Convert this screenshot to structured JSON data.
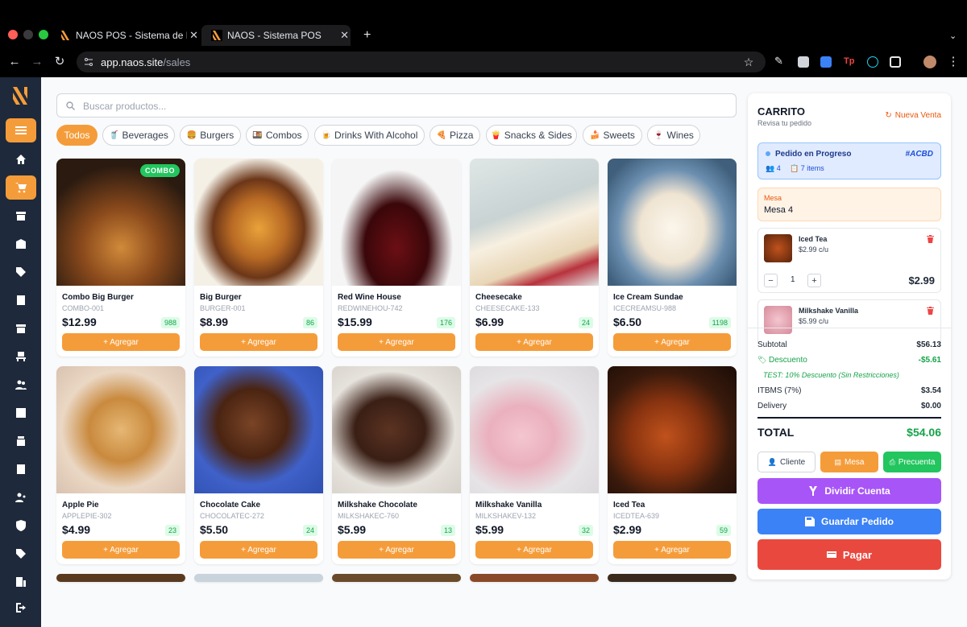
{
  "browser": {
    "tabs": [
      {
        "title": "NAOS POS - Sistema de Punto"
      },
      {
        "title": "NAOS - Sistema POS"
      }
    ],
    "new_tab": "+",
    "url_host": "app.naos.site",
    "url_path": "/sales"
  },
  "search": {
    "placeholder": "Buscar productos..."
  },
  "categories": [
    {
      "label": "Todos",
      "emoji": ""
    },
    {
      "label": "Beverages",
      "emoji": "🥤"
    },
    {
      "label": "Burgers",
      "emoji": "🍔"
    },
    {
      "label": "Combos",
      "emoji": "🍱"
    },
    {
      "label": "Drinks With Alcohol",
      "emoji": "🍺"
    },
    {
      "label": "Pizza",
      "emoji": "🍕"
    },
    {
      "label": "Snacks & Sides",
      "emoji": "🍟"
    },
    {
      "label": "Sweets",
      "emoji": "🍰"
    },
    {
      "label": "Wines",
      "emoji": "🍷"
    }
  ],
  "add_label": "+ Agregar",
  "combo_badge": "COMBO",
  "products": [
    {
      "name": "Combo Big Burger",
      "sku": "COMBO-001",
      "price": "$12.99",
      "stock": "988"
    },
    {
      "name": "Big Burger",
      "sku": "BURGER-001",
      "price": "$8.99",
      "stock": "86"
    },
    {
      "name": "Red Wine House",
      "sku": "REDWINEHOU-742",
      "price": "$15.99",
      "stock": "176"
    },
    {
      "name": "Cheesecake",
      "sku": "CHEESECAKE-133",
      "price": "$6.99",
      "stock": "24"
    },
    {
      "name": "Ice Cream Sundae",
      "sku": "ICECREAMSU-988",
      "price": "$6.50",
      "stock": "1198"
    },
    {
      "name": "Apple Pie",
      "sku": "APPLEPIE-302",
      "price": "$4.99",
      "stock": "23"
    },
    {
      "name": "Chocolate Cake",
      "sku": "CHOCOLATEC-272",
      "price": "$5.50",
      "stock": "24"
    },
    {
      "name": "Milkshake Chocolate",
      "sku": "MILKSHAKEC-760",
      "price": "$5.99",
      "stock": "13"
    },
    {
      "name": "Milkshake Vanilla",
      "sku": "MILKSHAKEV-132",
      "price": "$5.99",
      "stock": "32"
    },
    {
      "name": "Iced Tea",
      "sku": "ICEDTEA-639",
      "price": "$2.99",
      "stock": "59"
    }
  ],
  "cart": {
    "title": "CARRITO",
    "subtitle": "Revisa tu pedido",
    "new_sale": "Nueva Venta",
    "order_status": "Pedido en Progreso",
    "order_code": "#ACBD",
    "guests": "4",
    "items_count": "7 items",
    "mesa_label": "Mesa",
    "mesa_value": "Mesa 4",
    "items": [
      {
        "name": "Iced Tea",
        "unit": "$2.99 c/u",
        "qty": "1",
        "total": "$2.99"
      },
      {
        "name": "Milkshake Vanilla",
        "unit": "$5.99 c/u"
      }
    ],
    "subtotal_label": "Subtotal",
    "subtotal": "$56.13",
    "discount_label": "Descuento",
    "discount": "-$5.61",
    "discount_note": "TEST: 10% Descuento (Sin Restricciones)",
    "tax_label": "ITBMS (7%)",
    "tax": "$3.54",
    "delivery_label": "Delivery",
    "delivery": "$0.00",
    "total_label": "TOTAL",
    "total": "$54.06",
    "btn_cliente": "Cliente",
    "btn_mesa": "Mesa",
    "btn_precuenta": "Precuenta",
    "btn_dividir": "Dividir Cuenta",
    "btn_guardar": "Guardar Pedido",
    "btn_pagar": "Pagar"
  },
  "colors": {
    "accent": "#f59c3a",
    "sidebar": "#1e293b",
    "purple": "#a855f7",
    "blue": "#3b82f6",
    "red": "#ef4444",
    "green": "#22c55e"
  }
}
